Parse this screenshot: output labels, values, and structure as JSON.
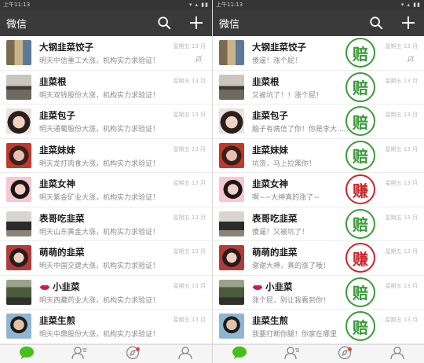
{
  "colors": {
    "accent": "#45c01a",
    "loss": "#3a9a3a",
    "gain": "#c8262b",
    "appbar": "#3a3a3a"
  },
  "left": {
    "status_time": "上午11:13",
    "title": "微信",
    "chats": [
      {
        "name": "大钢韭菜饺子",
        "msg": "明天中信重工大涨，机构实力求验证！",
        "time": "星期五 13 月",
        "muted": true,
        "avatar": "av1"
      },
      {
        "name": "韭菜根",
        "msg": "明天双钱股份大涨，机构实力求验证！",
        "time": "星期五 13 月",
        "avatar": "av2"
      },
      {
        "name": "韭菜包子",
        "msg": "明天通葡股份大涨，机构实力求验证！",
        "time": "星期五 13 月",
        "avatar": "av3"
      },
      {
        "name": "韭菜妹妹",
        "msg": "明天龙打肉食大涨，机构实力求验证！",
        "time": "星期五 13 月",
        "avatar": "av4"
      },
      {
        "name": "韭菜女神",
        "msg": "明天紫金矿业大涨，机构实力求验证！",
        "time": "星期五 13 月",
        "avatar": "av5"
      },
      {
        "name": "表哥吃韭菜",
        "msg": "明天山东黄金大涨，机构实力求验证！",
        "time": "星期五 13 月",
        "avatar": "av6"
      },
      {
        "name": "萌萌的韭菜",
        "msg": "明天中国交建大涨，机构实力求验证！",
        "time": "星期五 13 月",
        "avatar": "av7"
      },
      {
        "name": "小韭菜",
        "msg": "明天西藏药业大涨，机构实力求验证！",
        "time": "星期五 13 月",
        "lips": true,
        "avatar": "av8"
      },
      {
        "name": "韭菜生煎",
        "msg": "明天中鼎股份大涨，机构实力求验证！",
        "time": "星期五 13 月",
        "avatar": "av9"
      }
    ]
  },
  "right": {
    "status_time": "上午11:13",
    "title": "微信",
    "chats": [
      {
        "name": "大钢韭菜饺子",
        "msg": "傻逼！涨个屁！",
        "time": "星期五 13 月",
        "muted": true,
        "avatar": "av1",
        "stamp": "赔",
        "stamp_kind": "loss"
      },
      {
        "name": "韭菜根",
        "msg": "又被坑了！！涨个屁！",
        "time": "星期五 13 月",
        "avatar": "av2",
        "stamp": "赔",
        "stamp_kind": "loss"
      },
      {
        "name": "韭菜包子",
        "msg": "脑子有病信了你！你是李大……吧！",
        "time": "星期五 13 月",
        "avatar": "av3",
        "stamp": "赔",
        "stamp_kind": "loss"
      },
      {
        "name": "韭菜妹妹",
        "msg": "坑货，马上拉黑你！",
        "time": "星期五 13 月",
        "avatar": "av4",
        "stamp": "赔",
        "stamp_kind": "loss"
      },
      {
        "name": "韭菜女神",
        "msg": "啊~~大神真的涨了~",
        "time": "星期五 13 月",
        "avatar": "av5",
        "stamp": "赚",
        "stamp_kind": "gain"
      },
      {
        "name": "表哥吃韭菜",
        "msg": "傻逼！又被坑了！",
        "time": "星期五 13 月",
        "avatar": "av6",
        "stamp": "赔",
        "stamp_kind": "loss"
      },
      {
        "name": "萌萌的韭菜",
        "msg": "谢谢大神，真的涨了哦！",
        "time": "星期五 13 月",
        "avatar": "av7",
        "stamp": "赚",
        "stamp_kind": "gain"
      },
      {
        "name": "小韭菜",
        "msg": "涨个屁，别让我看到你！",
        "time": "星期五 13 月",
        "lips": true,
        "avatar": "av8",
        "stamp": "赔",
        "stamp_kind": "loss"
      },
      {
        "name": "韭菜生煎",
        "msg": "我要打断你腿！你家在哪里",
        "time": "星期五 13 月",
        "avatar": "av9",
        "stamp": "赔",
        "stamp_kind": "loss"
      }
    ]
  },
  "tabs": [
    {
      "id": "chats",
      "icon": "chat-bubble-icon",
      "active": true
    },
    {
      "id": "contacts",
      "icon": "contacts-icon"
    },
    {
      "id": "discover",
      "icon": "compass-icon",
      "badge": true
    },
    {
      "id": "me",
      "icon": "person-icon"
    }
  ]
}
